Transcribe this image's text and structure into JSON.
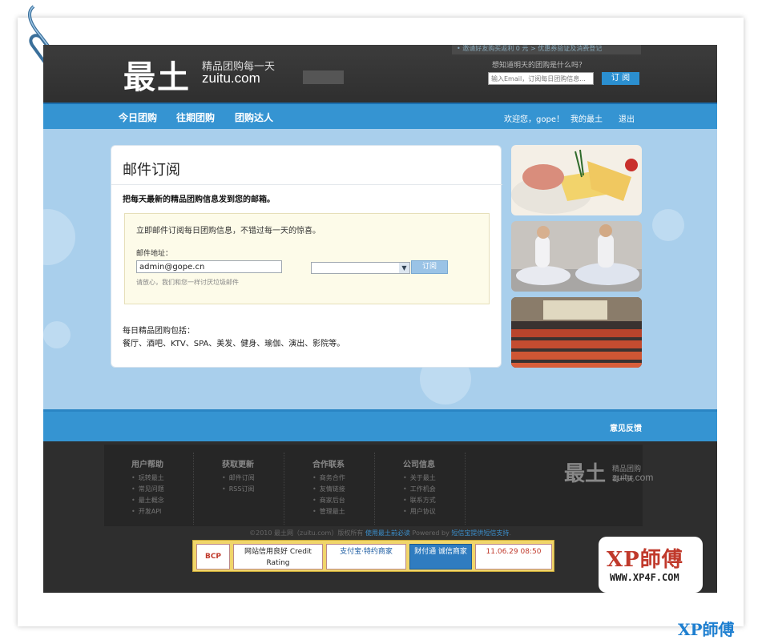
{
  "header": {
    "logo": "最土",
    "slogan": "精品团购每一天",
    "domain": "zuitu.com",
    "topbar": "• 邀请好友购买返利 0 元    > 优惠券验证及消费登记",
    "question": "想知道明天的团购是什么吗？",
    "email_placeholder": "输入Email，订阅每日团购信息...",
    "subscribe_label": "订 阅"
  },
  "nav": {
    "items": [
      "今日团购",
      "往期团购",
      "团购达人"
    ],
    "welcome": "欢迎您，gope！",
    "my_account": "我的最土",
    "logout": "退出"
  },
  "card": {
    "title": "邮件订阅",
    "subtitle": "把每天最新的精品团购信息发到您的邮箱。",
    "intro": "立即邮件订阅每日团购信息，不错过每一天的惊喜。",
    "email_label": "邮件地址：",
    "email_value": "admin@gope.cn",
    "hint": "请放心，我们和您一样讨厌垃圾邮件",
    "submit_label": "订阅",
    "includes_title": "每日精品团购包括：",
    "includes_list": "餐厅、酒吧、KTV、SPA、美发、健身、瑜伽、演出、影院等。"
  },
  "feedback": "意见反馈",
  "footer": {
    "columns": [
      {
        "title": "用户帮助",
        "items": [
          "玩转最土",
          "常见问题",
          "最土概念",
          "开发API"
        ]
      },
      {
        "title": "获取更新",
        "items": [
          "邮件订阅",
          "RSS订阅"
        ]
      },
      {
        "title": "合作联系",
        "items": [
          "商务合作",
          "友情链接",
          "商家后台",
          "管理最土"
        ]
      },
      {
        "title": "公司信息",
        "items": [
          "关于最土",
          "工作机会",
          "联系方式",
          "用户协议"
        ]
      }
    ],
    "logo": "最土",
    "slogan": "精品团购每一天",
    "domain": "zuitu.com",
    "copyright_a": "©2010 最土网（zuitu.com）版权所有 ",
    "copyright_link1": "使用最土前必读",
    "copyright_b": "  Powered by ",
    "copyright_link2": "短信宝提供短信支持",
    "copyright_c": ".",
    "badges": [
      "BCP",
      "网站信用良好 Credit Rating",
      "支付宝·特约商家",
      "财付通 诚信商家",
      "11.06.29 08:50"
    ]
  },
  "watermark": {
    "title": "XP師傅",
    "url": "WWW.XP4F.COM",
    "corner": "XP師傅"
  }
}
